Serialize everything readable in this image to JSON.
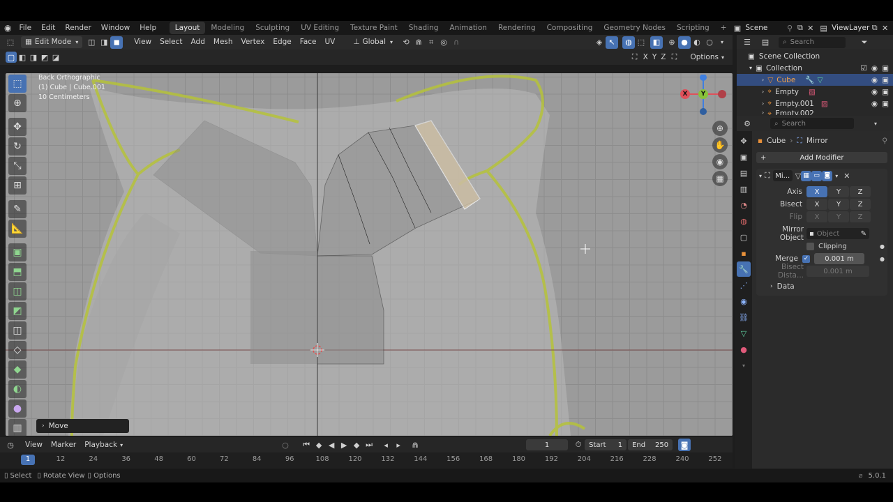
{
  "topbar": {
    "menus": [
      "File",
      "Edit",
      "Render",
      "Window",
      "Help"
    ],
    "workspaces": [
      "Layout",
      "Modeling",
      "Sculpting",
      "UV Editing",
      "Texture Paint",
      "Shading",
      "Animation",
      "Rendering",
      "Compositing",
      "Geometry Nodes",
      "Scripting"
    ],
    "active_workspace": "Layout",
    "add_workspace": "+",
    "scene_label": "Scene",
    "viewlayer_label": "ViewLayer"
  },
  "viewport_header": {
    "mode": "Edit Mode",
    "menus": [
      "View",
      "Select",
      "Add",
      "Mesh",
      "Vertex",
      "Edge",
      "Face",
      "UV"
    ],
    "orientation": "Global",
    "axis_x": "X",
    "axis_y": "Y",
    "axis_z": "Z",
    "options": "Options"
  },
  "viewport": {
    "view_name": "Back Orthographic",
    "object_info": "(1) Cube | Cube.001",
    "scale_info": "10 Centimeters",
    "last_operator": "Move",
    "gizmo_x": "X",
    "gizmo_y": "Y"
  },
  "timeline": {
    "menus": [
      "View",
      "Marker",
      "Playback"
    ],
    "current_frame": "1",
    "start_label": "Start",
    "start_value": "1",
    "end_label": "End",
    "end_value": "250",
    "frame_ticks": [
      "1",
      "12",
      "24",
      "36",
      "48",
      "60",
      "72",
      "84",
      "96",
      "108",
      "120",
      "132",
      "144",
      "156",
      "168",
      "180",
      "192",
      "204",
      "216",
      "228",
      "240",
      "252"
    ]
  },
  "statusbar": {
    "select": "Select",
    "rotate": "Rotate View",
    "options": "Options",
    "version": "5.0.1"
  },
  "outliner": {
    "search_placeholder": "Search",
    "scene_collection": "Scene Collection",
    "collection": "Collection",
    "items": [
      "Cube",
      "Empty",
      "Empty.001",
      "Empty.002"
    ]
  },
  "properties": {
    "search_placeholder": "Search",
    "breadcrumb_object": "Cube",
    "breadcrumb_modifier": "Mirror",
    "add_modifier": "Add Modifier",
    "modifier_name": "Mi...",
    "axis_label": "Axis",
    "bisect_label": "Bisect",
    "flip_label": "Flip",
    "x": "X",
    "y": "Y",
    "z": "Z",
    "mirror_object_label": "Mirror Object",
    "mirror_object_placeholder": "Object",
    "clipping_label": "Clipping",
    "merge_label": "Merge",
    "merge_value": "0.001 m",
    "bisect_distance_label": "Bisect Dista...",
    "bisect_distance_value": "0.001 m",
    "data_label": "Data"
  },
  "colors": {
    "accent": "#4772b3",
    "selection": "#334d80",
    "reference_outline": "#b5c23a",
    "gizmo_x": "#e0505a",
    "gizmo_y": "#88c23a",
    "gizmo_z": "#3f7fe0"
  }
}
